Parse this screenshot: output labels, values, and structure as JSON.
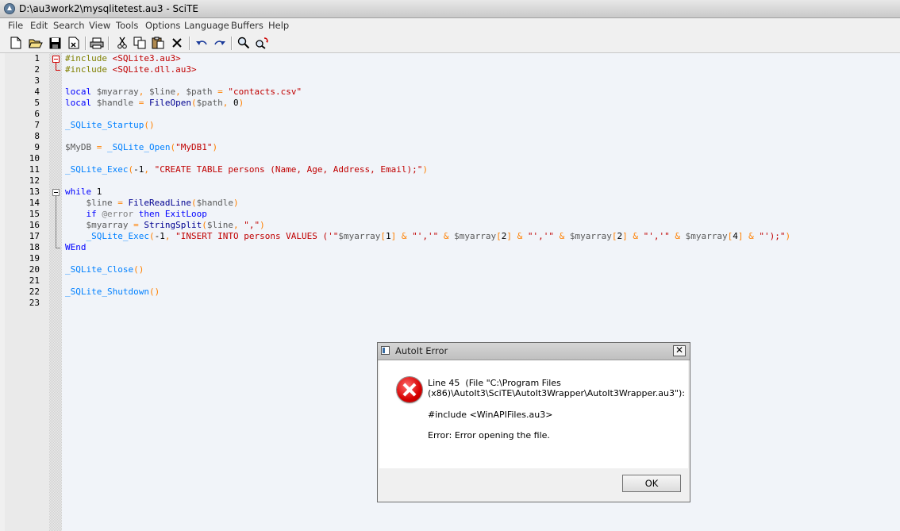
{
  "window": {
    "title": "D:\\au3work2\\mysqlitetest.au3 - SciTE"
  },
  "menu": [
    "File",
    "Edit",
    "Search",
    "View",
    "Tools",
    "Options",
    "Language",
    "Buffers",
    "Help"
  ],
  "toolbar": [
    "new-icon",
    "open-icon",
    "save-icon",
    "close-file-icon",
    "print-icon",
    "cut-icon",
    "copy-icon",
    "paste-icon",
    "delete-icon",
    "undo-icon",
    "redo-icon",
    "find-icon",
    "replace-icon"
  ],
  "editor": {
    "line_numbers": [
      "1",
      "2",
      "3",
      "4",
      "5",
      "6",
      "7",
      "8",
      "9",
      "10",
      "11",
      "12",
      "13",
      "14",
      "15",
      "16",
      "17",
      "18",
      "19",
      "20",
      "21",
      "22",
      "23"
    ],
    "lines": [
      [
        [
          "#include ",
          "pre"
        ],
        [
          "<SQLite3.au3>",
          "str"
        ]
      ],
      [
        [
          "#include ",
          "pre"
        ],
        [
          "<SQLite.dll.au3>",
          "str"
        ]
      ],
      [],
      [
        [
          "local ",
          "kw"
        ],
        [
          "$myarray",
          "var"
        ],
        [
          ", ",
          "op"
        ],
        [
          "$line",
          "var"
        ],
        [
          ", ",
          "op"
        ],
        [
          "$path",
          "var"
        ],
        [
          " = ",
          "op"
        ],
        [
          "\"contacts.csv\"",
          "str"
        ]
      ],
      [
        [
          "local ",
          "kw"
        ],
        [
          "$handle",
          "var"
        ],
        [
          " = ",
          "op"
        ],
        [
          "FileOpen",
          "fn"
        ],
        [
          "(",
          "op"
        ],
        [
          "$path",
          "var"
        ],
        [
          ", ",
          "op"
        ],
        [
          "0",
          "num"
        ],
        [
          ")",
          "op"
        ]
      ],
      [],
      [
        [
          "_SQLite_Startup",
          "udf"
        ],
        [
          "()",
          "op"
        ]
      ],
      [],
      [
        [
          "$MyDB",
          "var"
        ],
        [
          " = ",
          "op"
        ],
        [
          "_SQLite_Open",
          "udf"
        ],
        [
          "(",
          "op"
        ],
        [
          "\"MyDB1\"",
          "str"
        ],
        [
          ")",
          "op"
        ]
      ],
      [],
      [
        [
          "_SQLite_Exec",
          "udf"
        ],
        [
          "(",
          "op"
        ],
        [
          "-1",
          "num"
        ],
        [
          ", ",
          "op"
        ],
        [
          "\"CREATE TABLE persons (Name, Age, Address, Email);\"",
          "str"
        ],
        [
          ")",
          "op"
        ]
      ],
      [],
      [
        [
          "while ",
          "kw"
        ],
        [
          "1",
          "num"
        ]
      ],
      [
        [
          "    ",
          ""
        ],
        [
          "$line",
          "var"
        ],
        [
          " = ",
          "op"
        ],
        [
          "FileReadLine",
          "fn"
        ],
        [
          "(",
          "op"
        ],
        [
          "$handle",
          "var"
        ],
        [
          ")",
          "op"
        ]
      ],
      [
        [
          "    ",
          ""
        ],
        [
          "if ",
          "kw"
        ],
        [
          "@error",
          "macro"
        ],
        [
          " then ",
          "kw"
        ],
        [
          "ExitLoop",
          "kw"
        ]
      ],
      [
        [
          "    ",
          ""
        ],
        [
          "$myarray",
          "var"
        ],
        [
          " = ",
          "op"
        ],
        [
          "StringSplit",
          "fn"
        ],
        [
          "(",
          "op"
        ],
        [
          "$line",
          "var"
        ],
        [
          ", ",
          "op"
        ],
        [
          "\",\"",
          "str"
        ],
        [
          ")",
          "op"
        ]
      ],
      [
        [
          "    ",
          ""
        ],
        [
          "_SQLite_Exec",
          "udf"
        ],
        [
          "(",
          "op"
        ],
        [
          "-1",
          "num"
        ],
        [
          ", ",
          "op"
        ],
        [
          "\"INSERT INTO persons VALUES ('\"",
          "str"
        ],
        [
          "$myarray",
          "var"
        ],
        [
          "[",
          "op"
        ],
        [
          "1",
          "num"
        ],
        [
          "] & ",
          "op"
        ],
        [
          "\"','\"",
          "str"
        ],
        [
          " & ",
          "op"
        ],
        [
          "$myarray",
          "var"
        ],
        [
          "[",
          "op"
        ],
        [
          "2",
          "num"
        ],
        [
          "] & ",
          "op"
        ],
        [
          "\"','\"",
          "str"
        ],
        [
          " & ",
          "op"
        ],
        [
          "$myarray",
          "var"
        ],
        [
          "[",
          "op"
        ],
        [
          "2",
          "num"
        ],
        [
          "] & ",
          "op"
        ],
        [
          "\"','\"",
          "str"
        ],
        [
          " & ",
          "op"
        ],
        [
          "$myarray",
          "var"
        ],
        [
          "[",
          "op"
        ],
        [
          "4",
          "num"
        ],
        [
          "] & ",
          "op"
        ],
        [
          "\"');\"",
          "str"
        ],
        [
          ")",
          "op"
        ]
      ],
      [
        [
          "WEnd",
          "kw"
        ]
      ],
      [],
      [
        [
          "_SQLite_Close",
          "udf"
        ],
        [
          "()",
          "op"
        ]
      ],
      [],
      [
        [
          "_SQLite_Shutdown",
          "udf"
        ],
        [
          "()",
          "op"
        ]
      ],
      []
    ]
  },
  "dialog": {
    "title": "AutoIt Error",
    "close": "✕",
    "line1": "Line 45  (File \"C:\\Program Files",
    "line2": "(x86)\\AutoIt3\\SciTE\\AutoIt3Wrapper\\AutoIt3Wrapper.au3\"):",
    "line3": "#include <WinAPIFiles.au3>",
    "line4": "Error: Error opening the file.",
    "ok": "OK"
  }
}
